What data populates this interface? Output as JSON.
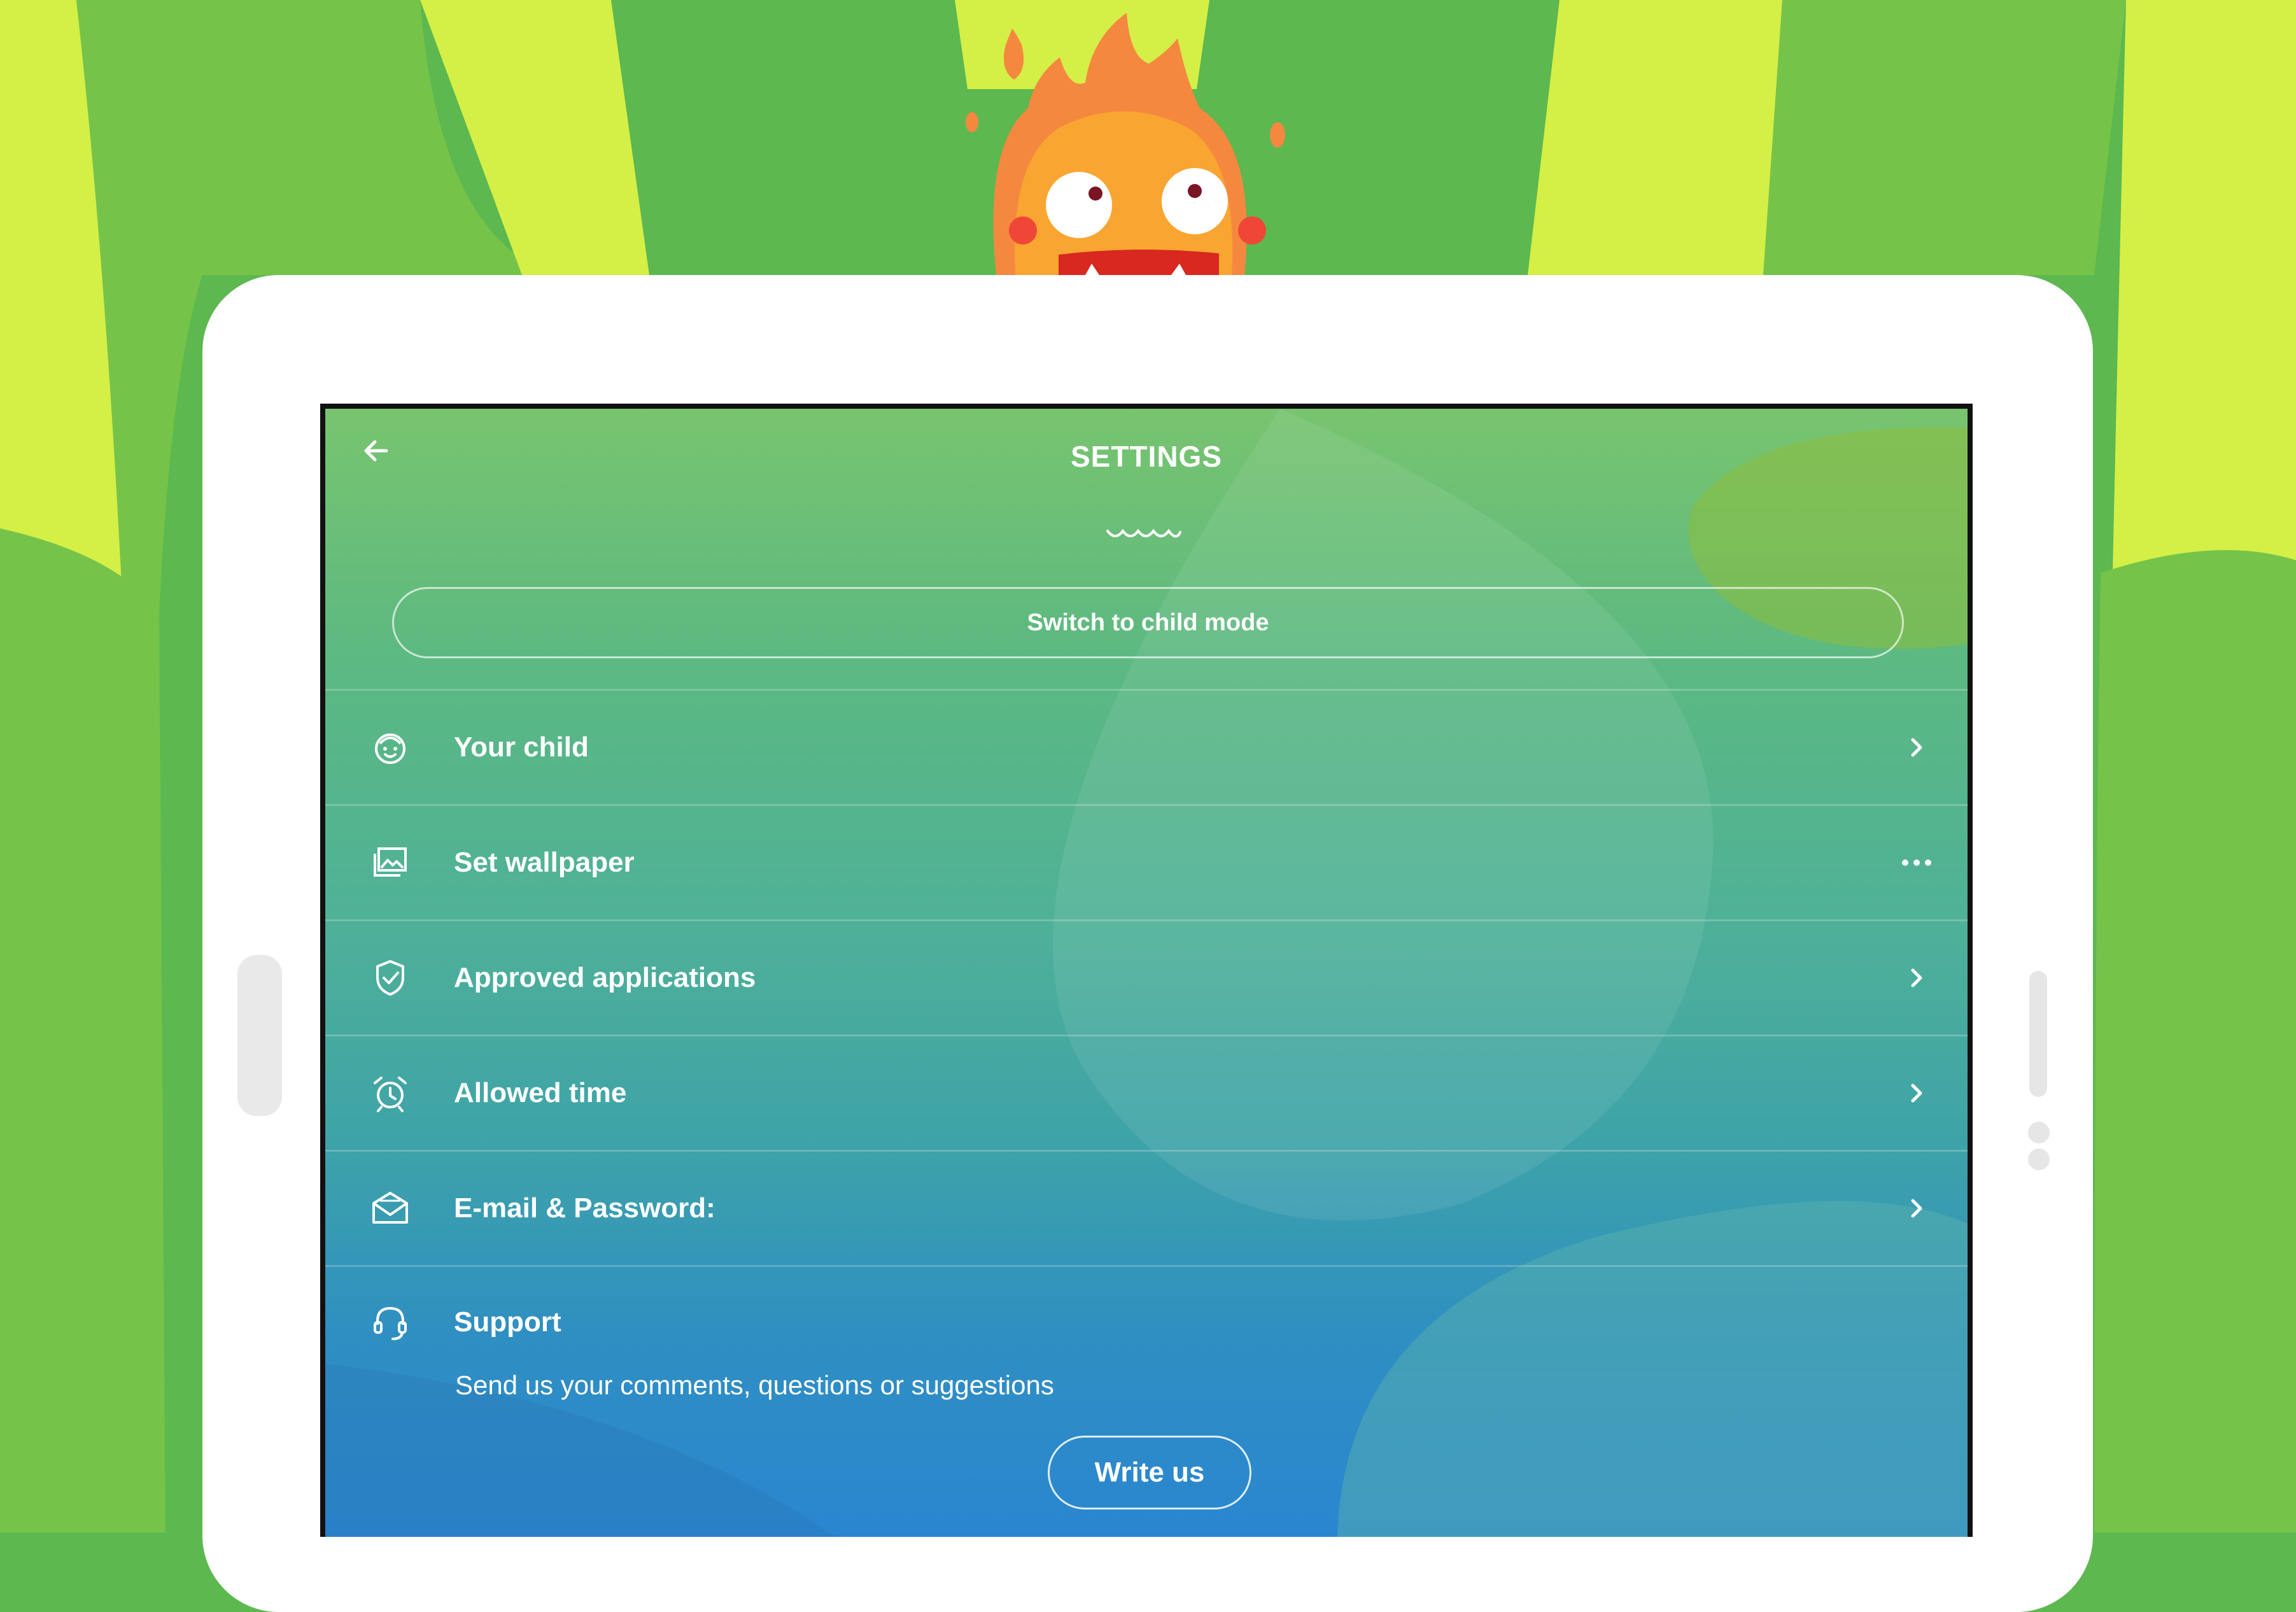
{
  "colors": {
    "stripe_light": "#d4ef46",
    "stripe_dark": "#5cb84f",
    "mascot": "#f5883f",
    "tablet": "#ffffff"
  },
  "header": {
    "back_icon": "arrow-left-icon",
    "title": "SETTINGS"
  },
  "switch_mode": {
    "label": "Switch to child mode"
  },
  "menu": {
    "items": [
      {
        "label": "Your child",
        "icon": "child-face-icon",
        "trailing": "chevron-right-icon"
      },
      {
        "label": "Set wallpaper",
        "icon": "image-gallery-icon",
        "trailing": "more-dots-icon"
      },
      {
        "label": "Approved applications",
        "icon": "shield-check-icon",
        "trailing": "chevron-right-icon"
      },
      {
        "label": "Allowed time",
        "icon": "alarm-clock-icon",
        "trailing": "chevron-right-icon"
      },
      {
        "label": "E-mail & Password:",
        "icon": "envelope-icon",
        "trailing": "chevron-right-icon"
      }
    ]
  },
  "support": {
    "icon": "headset-icon",
    "label": "Support",
    "description": "Send us your comments, questions or suggestions",
    "button_label": "Write us"
  }
}
